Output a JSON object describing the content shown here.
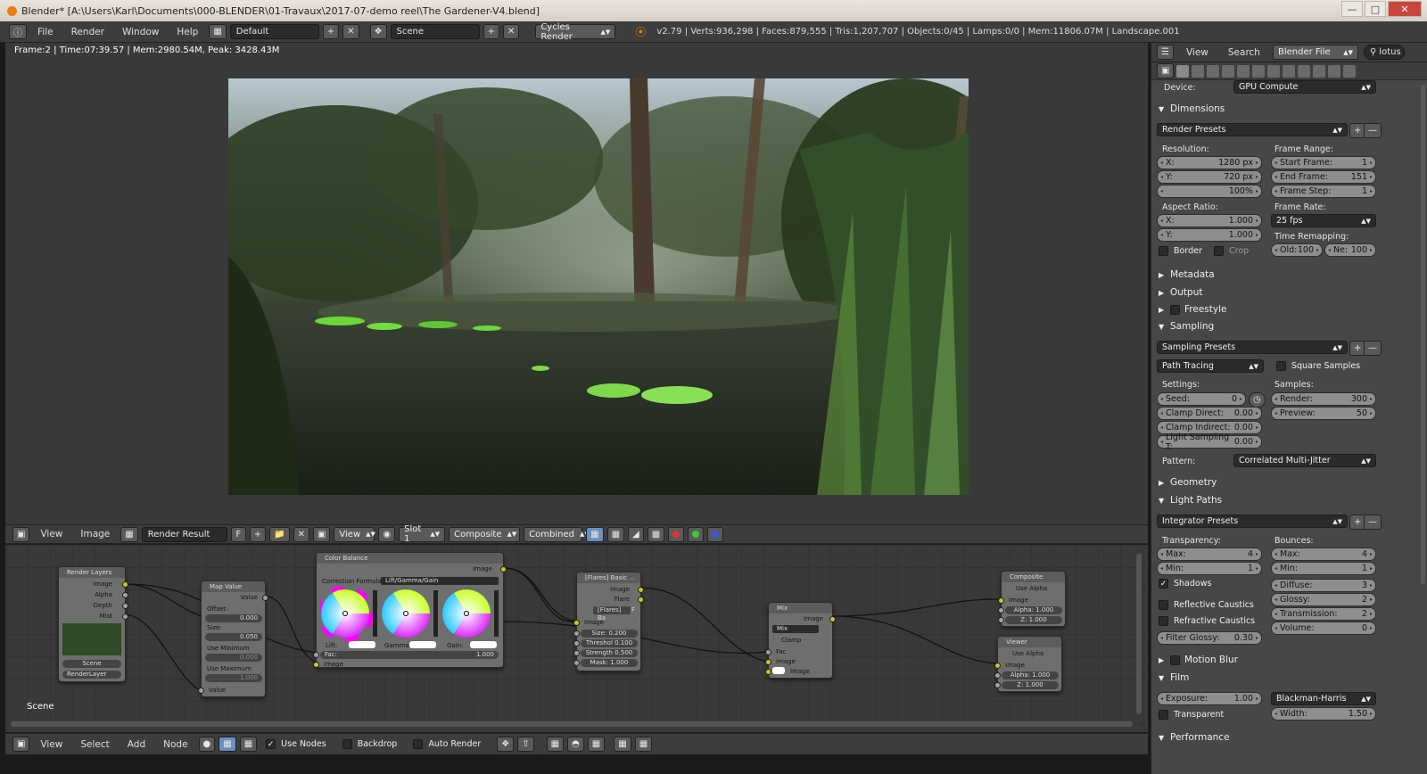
{
  "window": {
    "title": "Blender* [A:\\Users\\Karl\\Documents\\000-BLENDER\\01-Travaux\\2017-07-demo reel\\The Gardener-V4.blend]"
  },
  "menu": [
    "File",
    "Render",
    "Window",
    "Help"
  ],
  "layout": "Default",
  "scene": "Scene",
  "engine": "Cycles Render",
  "stats": "v2.79 | Verts:936,298 | Faces:879,555 | Tris:1,207,707 | Objects:0/45 | Lamps:0/0 | Mem:11806.07M | Landscape.001",
  "frame_info": "Frame:2 | Time:07:39.57 | Mem:2980.54M, Peak: 3428.43M",
  "image_editor": {
    "view": "View",
    "image": "Image",
    "image_name": "Render Result",
    "f": "F",
    "view2": "View",
    "slot": "Slot 1",
    "layer": "Composite",
    "pass": "Combined"
  },
  "node_editor": {
    "view": "View",
    "select": "Select",
    "add": "Add",
    "node": "Node",
    "use_nodes": "Use Nodes",
    "backdrop": "Backdrop",
    "auto_render": "Auto Render",
    "scene_label": "Scene"
  },
  "nodes": {
    "render_layers": {
      "title": "Render Layers",
      "outputs": [
        "Image",
        "Alpha",
        "Depth",
        "Mist"
      ],
      "scene": "Scene",
      "layer": "RenderLayer"
    },
    "map_value": {
      "title": "Map Value",
      "output": "Value",
      "offset_label": "Offset:",
      "offset": "0.000",
      "size_label": "Size:",
      "size": "0.050",
      "use_min": "Use Minimum",
      "min": "0.000",
      "use_max": "Use Maximum",
      "max": "1.000",
      "input": "Value"
    },
    "color_balance": {
      "title": "Color Balance",
      "output": "Image",
      "formula_label": "Correction Formula:",
      "formula": "Lift/Gamma/Gain",
      "lift": "Lift:",
      "gamma": "Gamma:",
      "gain": "Gain:",
      "fac_label": "Fac:",
      "fac": "1.000",
      "input": "Image"
    },
    "flares": {
      "title": "[Flares] Basic ...",
      "out1": "Image",
      "out2": "Flare",
      "group": "[Flares] Ba",
      "f": "F",
      "in": "Image",
      "size": "Size: 0.200",
      "threshold": "Threshol 0.100",
      "strength": "Strength 0.500",
      "mask": "Mask: 1.000"
    },
    "mix": {
      "title": "Mix",
      "output": "Image",
      "mode": "Mix",
      "clamp": "Clamp",
      "fac": "Fac",
      "in1": "Image",
      "in2": "Image"
    },
    "composite": {
      "title": "Composite",
      "use_alpha": "Use Alpha",
      "in": "Image",
      "alpha": "Alpha: 1.000",
      "z": "Z: 1.000"
    },
    "viewer": {
      "title": "Viewer",
      "use_alpha": "Use Alpha",
      "in": "Image",
      "alpha": "Alpha: 1.000",
      "z": "Z: 1.000"
    }
  },
  "props": {
    "header": {
      "view": "View",
      "search": "Search",
      "context": "Blender File",
      "search_value": "lotus"
    },
    "device_label": "Device:",
    "device": "GPU Compute",
    "dimensions": "Dimensions",
    "render_presets": "Render Presets",
    "resolution": "Resolution:",
    "res_x_l": "X:",
    "res_x": "1280 px",
    "res_y_l": "Y:",
    "res_y": "720 px",
    "res_pct": "100%",
    "frame_range": "Frame Range:",
    "start_l": "Start Frame:",
    "start": "1",
    "end_l": "End Frame:",
    "end": "151",
    "step_l": "Frame Step:",
    "step": "1",
    "aspect": "Aspect Ratio:",
    "asp_x_l": "X:",
    "asp_x": "1.000",
    "asp_y_l": "Y:",
    "asp_y": "1.000",
    "frame_rate": "Frame Rate:",
    "fps": "25 fps",
    "time_remap": "Time Remapping:",
    "old_l": "Old:",
    "old": "100",
    "new_l": "Ne:",
    "new": "100",
    "border": "Border",
    "crop": "Crop",
    "metadata": "Metadata",
    "output": "Output",
    "freestyle": "Freestyle",
    "sampling": "Sampling",
    "sampling_presets": "Sampling Presets",
    "path_tracing": "Path Tracing",
    "square_samples": "Square Samples",
    "settings": "Settings:",
    "samples": "Samples:",
    "seed_l": "Seed:",
    "seed": "0",
    "render_l": "Render:",
    "render": "300",
    "clamp_direct_l": "Clamp Direct:",
    "clamp_direct": "0.00",
    "preview_l": "Preview:",
    "preview": "50",
    "clamp_indirect_l": "Clamp Indirect:",
    "clamp_indirect": "0.00",
    "light_sampling_l": "Light Sampling T:",
    "light_sampling": "0.00",
    "pattern_l": "Pattern:",
    "pattern": "Correlated Multi-Jitter",
    "geometry": "Geometry",
    "light_paths": "Light Paths",
    "integrator_presets": "Integrator Presets",
    "transparency": "Transparency:",
    "bounces": "Bounces:",
    "t_max_l": "Max:",
    "t_max": "4",
    "t_min_l": "Min:",
    "t_min": "1",
    "b_max_l": "Max:",
    "b_max": "4",
    "b_min_l": "Min:",
    "b_min": "1",
    "shadows": "Shadows",
    "diffuse_l": "Diffuse:",
    "diffuse": "3",
    "glossy_l": "Glossy:",
    "glossy": "2",
    "reflective": "Reflective Caustics",
    "transmission_l": "Transmission:",
    "transmission": "2",
    "refractive": "Refractive Caustics",
    "volume_l": "Volume:",
    "volume": "0",
    "filter_glossy_l": "Filter Glossy:",
    "filter_glossy": "0.30",
    "motion_blur": "Motion Blur",
    "film": "Film",
    "exposure_l": "Exposure:",
    "exposure": "1.00",
    "filter": "Blackman-Harris",
    "transparent": "Transparent",
    "width_l": "Width:",
    "width": "1.50",
    "performance": "Performance"
  },
  "colors": {
    "accent": "#e87d0d",
    "panel": "#474747",
    "socket_yellow": "#c7c729",
    "socket_gray": "#a1a1a1"
  }
}
